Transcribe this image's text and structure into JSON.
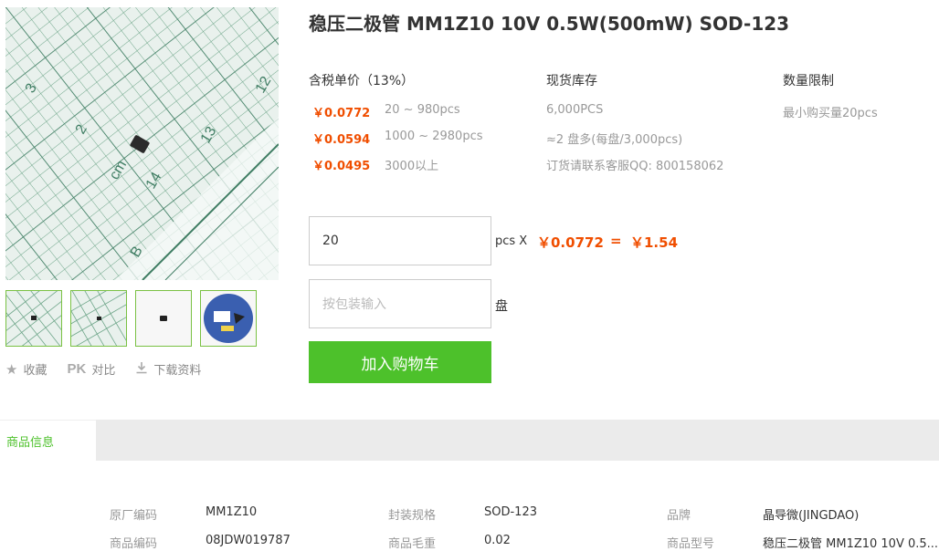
{
  "product": {
    "title": "稳压二极管 MM1Z10 10V 0.5W(500mW) SOD-123"
  },
  "gallery": {
    "main_image_alt": "product-photo-on-cutting-mat",
    "thumbnails": [
      "thumb-1",
      "thumb-2",
      "thumb-3",
      "thumb-4"
    ],
    "ruler_labels": [
      "3",
      "2",
      "cm",
      "1",
      "14",
      "13",
      "12",
      "B"
    ]
  },
  "actions": {
    "favorite_label": "收藏",
    "compare_pk": "PK",
    "compare_label": "对比",
    "download_label": "下载资料"
  },
  "pricing": {
    "header": "含税单价（13%）",
    "tiers": [
      {
        "price": "￥0.0772",
        "range": "20 ~ 980pcs"
      },
      {
        "price": "￥0.0594",
        "range": "1000 ~ 2980pcs"
      },
      {
        "price": "￥0.0495",
        "range": "3000以上"
      }
    ]
  },
  "stock": {
    "header": "现货库存",
    "lines": [
      "6,000PCS",
      "≈2 盘多(每盘/3,000pcs)",
      "订货请联系客服QQ: 800158062"
    ]
  },
  "limit": {
    "header": "数量限制",
    "min_purchase": "最小购买量20pcs"
  },
  "order": {
    "quantity_value": "20",
    "unit_label": "pcs X",
    "unit_price": "￥0.0772",
    "equals": "=",
    "total": "￥1.54",
    "reel_placeholder": "按包装输入",
    "reel_unit": "盘",
    "add_to_cart_label": "加入购物车"
  },
  "tabs": {
    "active_label": "商品信息"
  },
  "specs": [
    {
      "key": "原厂编码",
      "value": "MM1Z10"
    },
    {
      "key": "封装规格",
      "value": "SOD-123"
    },
    {
      "key": "品牌",
      "value": "晶导微(JINGDAO)"
    },
    {
      "key": "商品编码",
      "value": "08JDW019787"
    },
    {
      "key": "商品毛重",
      "value": "0.02"
    },
    {
      "key": "商品型号",
      "value": "稳压二极管 MM1Z10 10V 0.5..."
    }
  ],
  "colors": {
    "accent_price": "#f04e00",
    "cart_green": "#4dc12b",
    "thumb_border": "#7ac143"
  }
}
